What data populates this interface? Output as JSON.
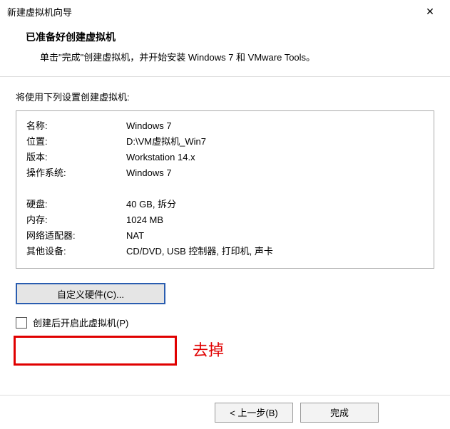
{
  "window": {
    "title": "新建虚拟机向导",
    "close_icon": "✕"
  },
  "header": {
    "title": "已准备好创建虚拟机",
    "description": "单击\"完成\"创建虚拟机，并开始安装 Windows 7 和 VMware Tools。"
  },
  "content": {
    "intro": "将使用下列设置创建虚拟机:"
  },
  "settings": {
    "rows": [
      {
        "label": "名称:",
        "value": "Windows 7"
      },
      {
        "label": "位置:",
        "value": "D:\\VM虚拟机_Win7"
      },
      {
        "label": "版本:",
        "value": "Workstation 14.x"
      },
      {
        "label": "操作系统:",
        "value": "Windows 7"
      }
    ],
    "rows2": [
      {
        "label": "硬盘:",
        "value": "40 GB, 拆分"
      },
      {
        "label": "内存:",
        "value": "1024 MB"
      },
      {
        "label": "网络适配器:",
        "value": "NAT"
      },
      {
        "label": "其他设备:",
        "value": "CD/DVD, USB 控制器, 打印机, 声卡"
      }
    ]
  },
  "buttons": {
    "customize": "自定义硬件(C)...",
    "back": "< 上一步(B)",
    "finish": "完成"
  },
  "checkbox": {
    "label": "创建后开启此虚拟机(P)"
  },
  "annotation": {
    "text": "去掉"
  }
}
